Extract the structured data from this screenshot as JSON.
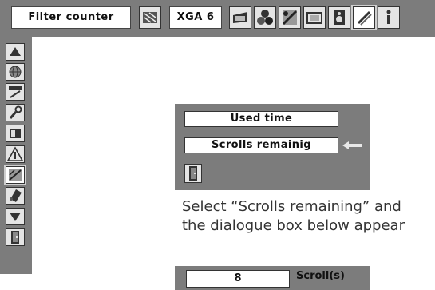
{
  "menubar": {
    "title": "Filter counter",
    "input_source": "XGA 6",
    "icons": [
      "filter-icon",
      "pc-adjust-icon",
      "image-select-icon",
      "image-adjust-icon",
      "screen-icon",
      "sound-icon",
      "setting-icon",
      "information-icon"
    ]
  },
  "sidebar": {
    "icons": [
      "up-arrow-icon",
      "language-globe-icon",
      "hdmi-icon",
      "wrench-icon",
      "screen-display-icon",
      "warning-icon",
      "filter-counter-icon",
      "remote-icon",
      "down-arrow-icon",
      "exit-door-icon"
    ]
  },
  "dialog": {
    "items": [
      "Used time",
      "Scrolls remainig"
    ],
    "exit_icon": "exit-door-icon"
  },
  "instruction": {
    "line1": "Select “Scrolls remaining” and",
    "line2": "the dialogue box below appear"
  },
  "dialog2": {
    "value": "8",
    "unit": "Scroll(s)"
  }
}
